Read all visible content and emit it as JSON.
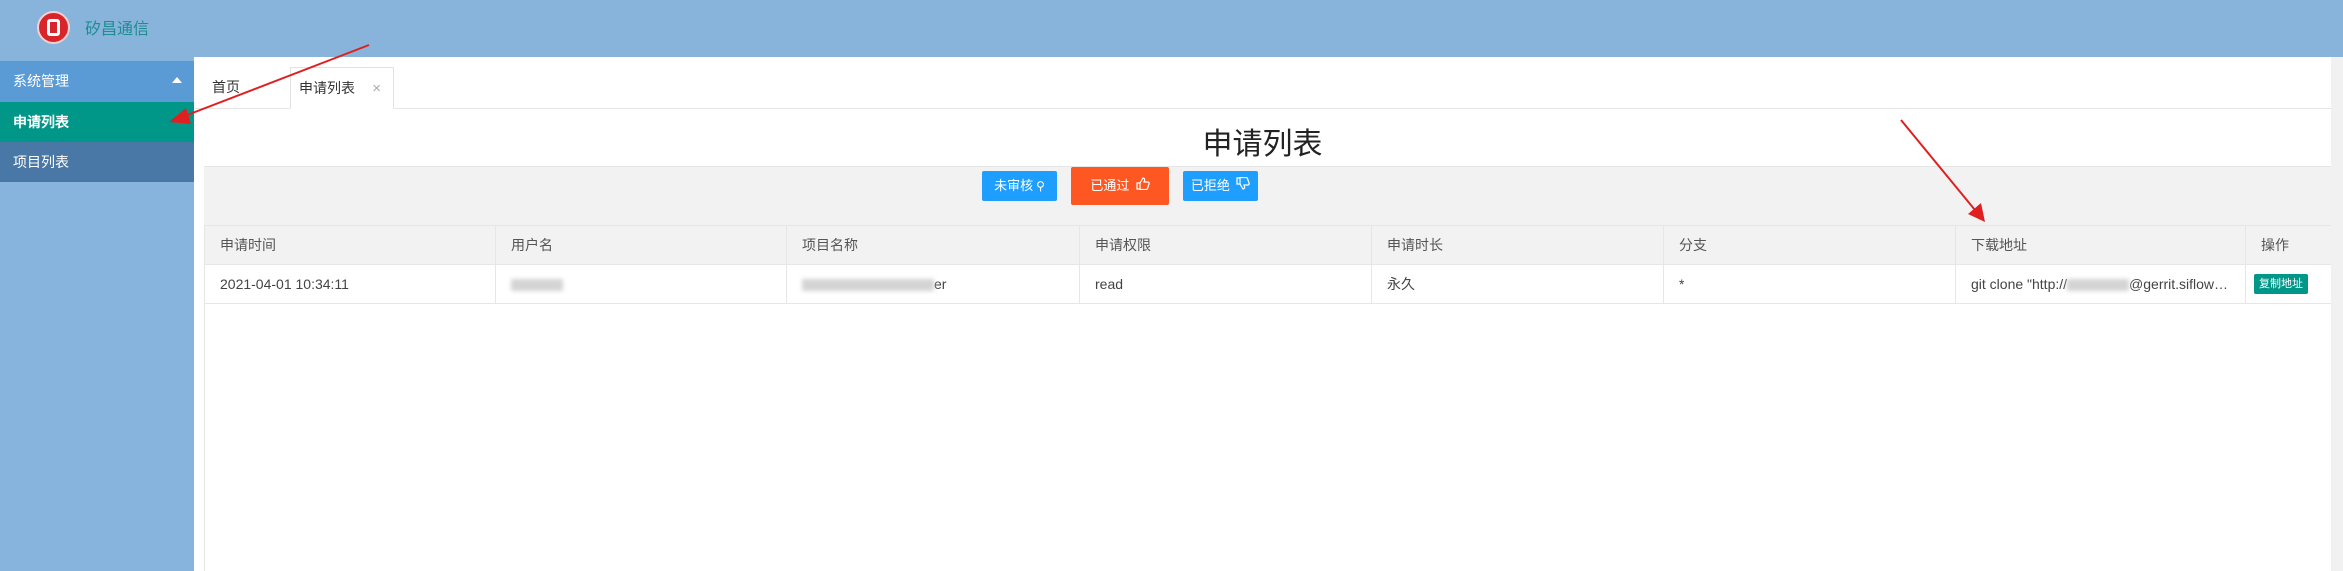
{
  "header": {
    "brand": "矽昌通信"
  },
  "sidebar": {
    "group_label": "系统管理",
    "items": [
      {
        "label": "申请列表"
      },
      {
        "label": "项目列表"
      }
    ]
  },
  "tabs": [
    {
      "label": "首页"
    },
    {
      "label": "申请列表",
      "close": "×"
    }
  ],
  "page": {
    "title": "申请列表"
  },
  "filters": [
    {
      "label": "未审核",
      "icon": "search-icon"
    },
    {
      "label": "已通过",
      "icon": "thumbs-up-icon"
    },
    {
      "label": "已拒绝",
      "icon": "thumbs-down-icon"
    }
  ],
  "table": {
    "columns": [
      "申请时间",
      "用户名",
      "项目名称",
      "申请权限",
      "申请时长",
      "分支",
      "下载地址",
      "操作"
    ],
    "rows": [
      {
        "time": "2021-04-01 10:34:11",
        "project_visible": "er",
        "permission": "read",
        "duration": "永久",
        "branch": "*",
        "url_prefix": "git clone \"http://",
        "url_suffix": "@gerrit.siflower...",
        "action": "复制地址"
      }
    ]
  },
  "colors": {
    "header_bg": "#88b3db",
    "active_menu": "#009688",
    "primary_button": "#1e9fff",
    "active_button": "#ff5722",
    "annotation_arrow": "#e02020"
  }
}
